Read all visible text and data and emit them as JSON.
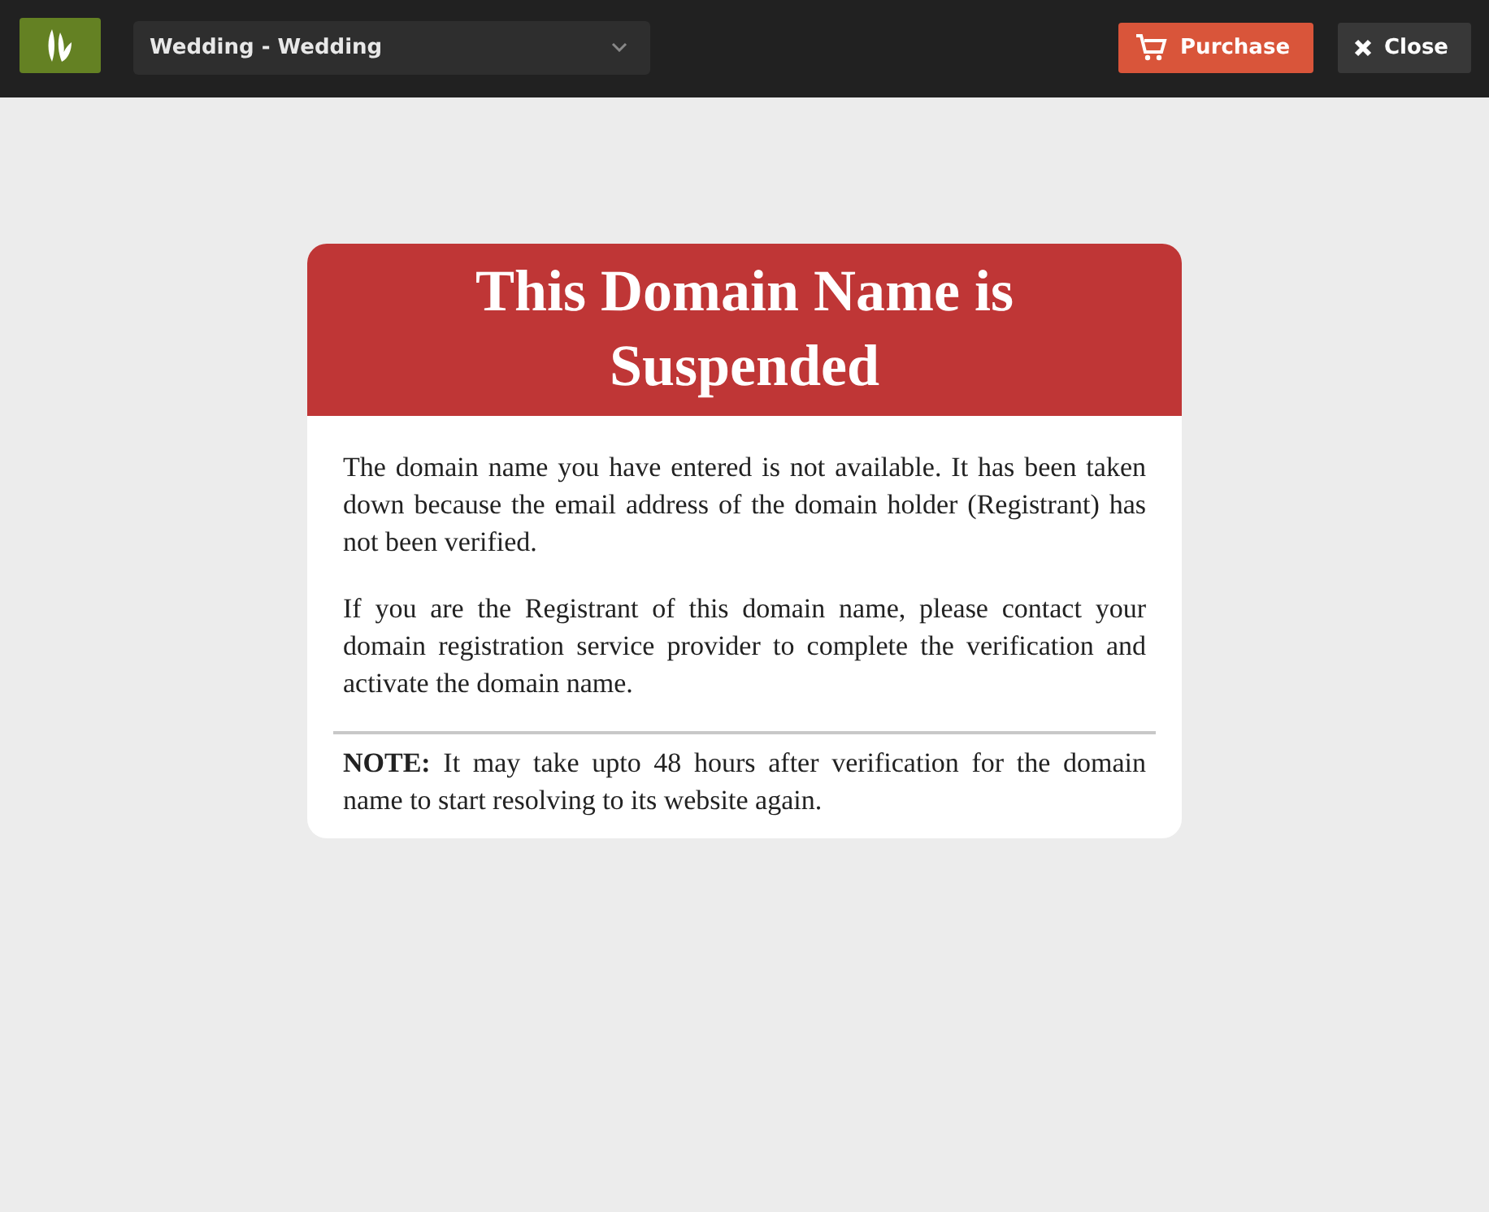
{
  "toolbar": {
    "theme_select": {
      "value": "Wedding - Wedding"
    },
    "buttons": [
      {
        "kind": "purchase",
        "label": "Purchase"
      },
      {
        "kind": "close",
        "label": "Close"
      }
    ]
  },
  "notice": {
    "title": "This Domain Name is Suspended",
    "paragraphs": [
      "The domain name you have entered is not available. It has been taken down because the email address of the domain holder (Registrant) has not been verified.",
      "If you are the Registrant of this domain name, please contact your domain registration service provider to complete the verification and activate the domain name."
    ],
    "note": "**NOTE:** It may take upto 48 hours after verification for the domain name to start resolving to its website again."
  }
}
